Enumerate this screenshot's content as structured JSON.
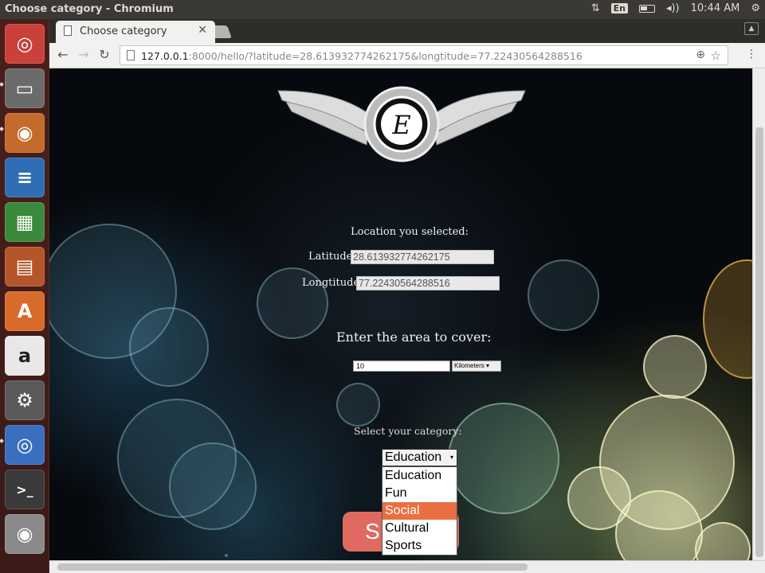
{
  "os": {
    "window_title": "Choose category - Chromium",
    "keyboard": "En",
    "clock": "10:44 AM"
  },
  "launcher": {
    "apps": [
      "ubuntu-icon",
      "files-icon",
      "firefox-icon",
      "writer-icon",
      "calc-icon",
      "impress-icon",
      "software-center-icon",
      "amazon-icon",
      "system-settings-icon",
      "chromium-icon",
      "terminal-icon",
      "dvd-icon",
      "trash-icon"
    ]
  },
  "browser": {
    "tab_title": "Choose category",
    "url_host": "127.0.0.1",
    "url_rest": ":8000/hello/?latitude=28.613932774262175&longtitude=77.22430564288516"
  },
  "page": {
    "location_heading": "Location you selected:",
    "latitude_label": "Latitude:",
    "latitude_value": "28.613932774262175",
    "longitude_label": "Longtitude:",
    "longitude_value": "77.22430564288516",
    "area_heading": "Enter the area to cover:",
    "area_value": "10",
    "unit_selected": "Kilometers",
    "category_heading": "Select your category:",
    "category_selected": "Education",
    "category_options": [
      "Education",
      "Fun",
      "Social",
      "Cultural",
      "Sports"
    ],
    "highlighted_option": "Social",
    "submit_label_visible": "S"
  },
  "colors": {
    "submit": "#e06a60",
    "highlight": "#e96f42",
    "launcher": "#4a1f1a"
  }
}
